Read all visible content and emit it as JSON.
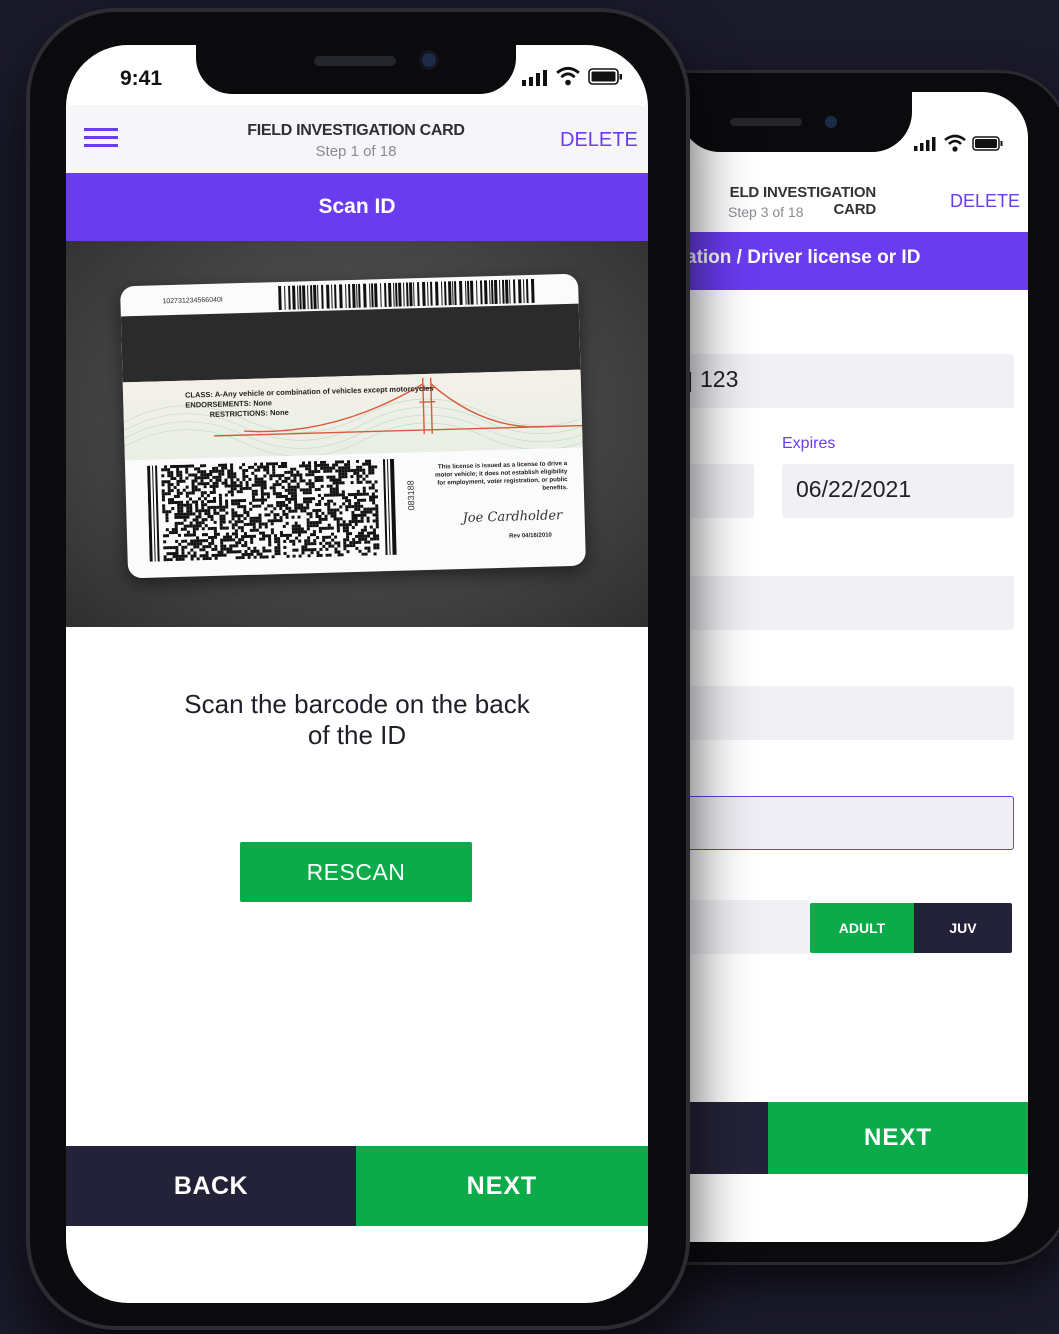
{
  "front": {
    "status_time": "9:41",
    "header_title": "FIELD INVESTIGATION CARD",
    "header_step": "Step 1 of 18",
    "delete_label": "DELETE",
    "banner_title": "Scan ID",
    "card": {
      "number": "102731234566040I",
      "class_line": "CLASS: A-Any vehicle or combination of vehicles except motorcycles",
      "endorsements": "ENDORSEMENTS: None",
      "restrictions": "RESTRICTIONS: None",
      "notice": "This license is issued as a license to drive a motor vehicle; it does not establish eligibility for employment, voter registration, or public benefits.",
      "side_number": "083188",
      "signature": "Joe Cardholder",
      "rev": "Rev 04/16/2010"
    },
    "instructions_line1": "Scan the barcode on the back",
    "instructions_line2": "of the ID",
    "rescan_label": "RESCAN",
    "back_label": "BACK",
    "next_label": "NEXT"
  },
  "back": {
    "header_title": "ELD INVESTIGATION CARD",
    "header_step": "Step 3 of 18",
    "delete_label": "DELETE",
    "banner_title": "ation / Driver license or ID",
    "id_value": "123",
    "expires_label": "Expires",
    "expires_value": "06/22/2021",
    "adult_label": "ADULT",
    "juv_label": "JUV",
    "next_label": "NEXT"
  },
  "colors": {
    "accent": "#6a3cf0",
    "green": "#0bab4a",
    "navy": "#242238",
    "background": "#1b1a2b"
  },
  "icons": [
    "hamburger-menu-icon",
    "signal-icon",
    "wifi-icon",
    "battery-icon"
  ]
}
